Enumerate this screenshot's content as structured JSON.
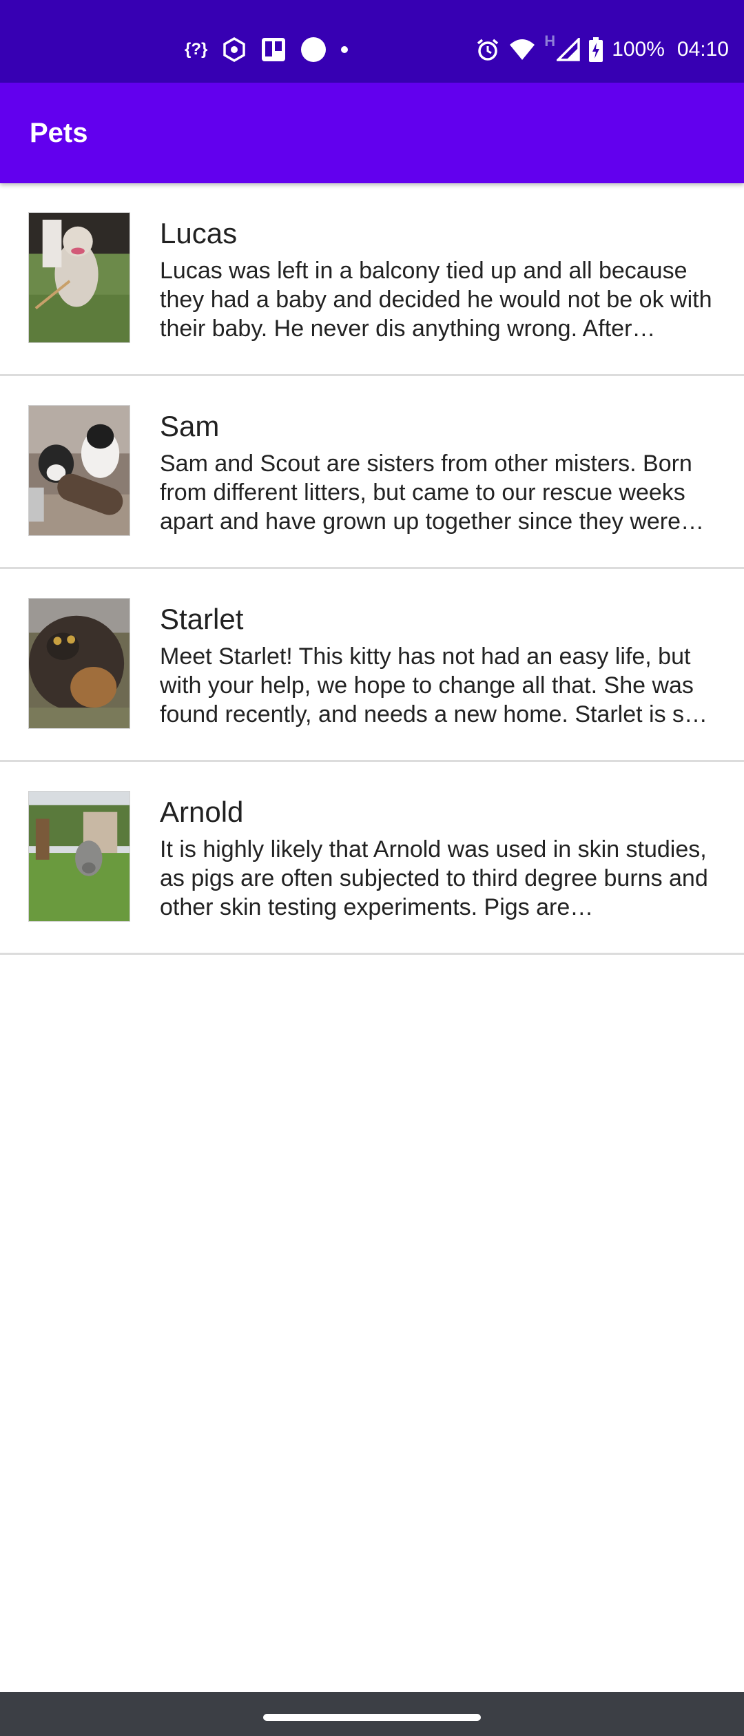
{
  "status_bar": {
    "left_icons": [
      "code-bracket-icon",
      "hexagon-app-icon",
      "trello-icon",
      "circle-notification-icon",
      "more-notifications-dot-icon"
    ],
    "left_glyph_text": "{?}",
    "network_indicator": "H",
    "battery": "100%",
    "time": "04:10"
  },
  "app_bar": {
    "title": "Pets"
  },
  "pets": [
    {
      "name": "Lucas",
      "description": "Lucas was left in a balcony tied up and all because they had a baby and decided he would not be ok with their baby. He never dis anything wrong. After…"
    },
    {
      "name": "Sam",
      "description": "Sam and Scout are sisters from other misters. Born from different litters, but came to our rescue weeks apart and have grown up together since they were…"
    },
    {
      "name": "Starlet",
      "description": "Meet Starlet! This kitty has not had an easy life, but with your help, we hope to change all that. She was found recently, and needs a new home. Starlet is s…"
    },
    {
      "name": "Arnold",
      "description": "It is highly likely that Arnold was used in skin studies, as pigs are often subjected to third degree burns and other skin testing experiments. Pigs are…"
    }
  ],
  "colors": {
    "status_bar": "#3700b3",
    "app_bar": "#6200ee",
    "nav_bar": "#3c3f45",
    "divider": "#dcdcdc"
  }
}
